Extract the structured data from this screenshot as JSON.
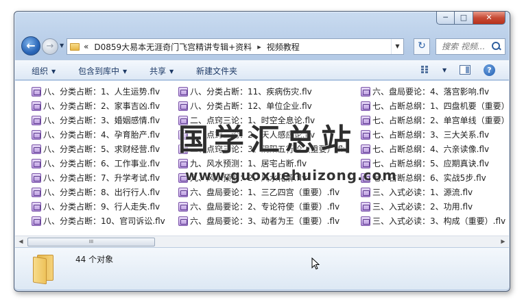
{
  "window": {
    "caption_buttons": {
      "minimize": "─",
      "maximize": "□",
      "close": "✕"
    }
  },
  "navigation": {
    "back_glyph": "←",
    "forward_glyph": "→",
    "history_glyph": "▼",
    "breadcrumb_prefix": "«",
    "breadcrumb": [
      "D0859大易本无涯奇门飞宫精讲专辑+资料",
      "视频教程"
    ],
    "breadcrumb_separator": "▸",
    "refresh_glyph": "↻",
    "search_placeholder": "搜索 视频..."
  },
  "toolbar": {
    "organize": "组织",
    "include_in_library": "包含到库中",
    "share": "共享",
    "new_folder": "新建文件夹",
    "help": "?"
  },
  "files": {
    "column1": [
      "八、分类占断：1、人生运势.flv",
      "八、分类占断：2、家事吉凶.flv",
      "八、分类占断：3、婚姻感情.flv",
      "八、分类占断：4、孕育胎产.flv",
      "八、分类占断：5、求财经营.flv",
      "八、分类占断：6、工作事业.flv",
      "八、分类占断：7、升学考试.flv",
      "八、分类占断：8、出行行人.flv",
      "八、分类占断：9、行人走失.flv",
      "八、分类占断：10、官司诉讼.flv"
    ],
    "column2": [
      "八、分类占断：11、疾病伤灾.flv",
      "八、分类占断：12、单位企业.flv",
      "二、点窍三论：1、时空全息论.flv",
      "二、点窍三论：2、天人感应论.flv",
      "二、点窍三论：3、阴阳五行论（重要）.flv",
      "九、风水预测：1、居宅占断.flv",
      "九、风水预测：2、风水化解.flv",
      "六、盘局要论：1、三乙四宫（重要）.flv",
      "六、盘局要论：2、专论符使（重要）.flv",
      "六、盘局要论：3、动者为王（重要）.flv"
    ],
    "column3": [
      "六、盘局要论：4、落宫影响.flv",
      "七、占断总纲：1、四盘机要（重要）",
      "七、占断总纲：2、单宫单线（重要）",
      "七、占断总纲：3、三大关系.flv",
      "七、占断总纲：4、六亲读像.flv",
      "七、占断总纲：5、应期真诀.flv",
      "七、占断总纲：6、实战5步.flv",
      "三、入式必读：1、源流.flv",
      "三、入式必读：2、功用.flv",
      "三、入式必读：3、构成（重要）.flv"
    ]
  },
  "watermark": {
    "text": "国学汇总站",
    "url": "www.guoxuehuizong.com"
  },
  "scrollbar": {
    "left_arrow": "◀",
    "right_arrow": "▶",
    "thumb_grip": "III"
  },
  "status": {
    "object_count": "44 个对象"
  }
}
